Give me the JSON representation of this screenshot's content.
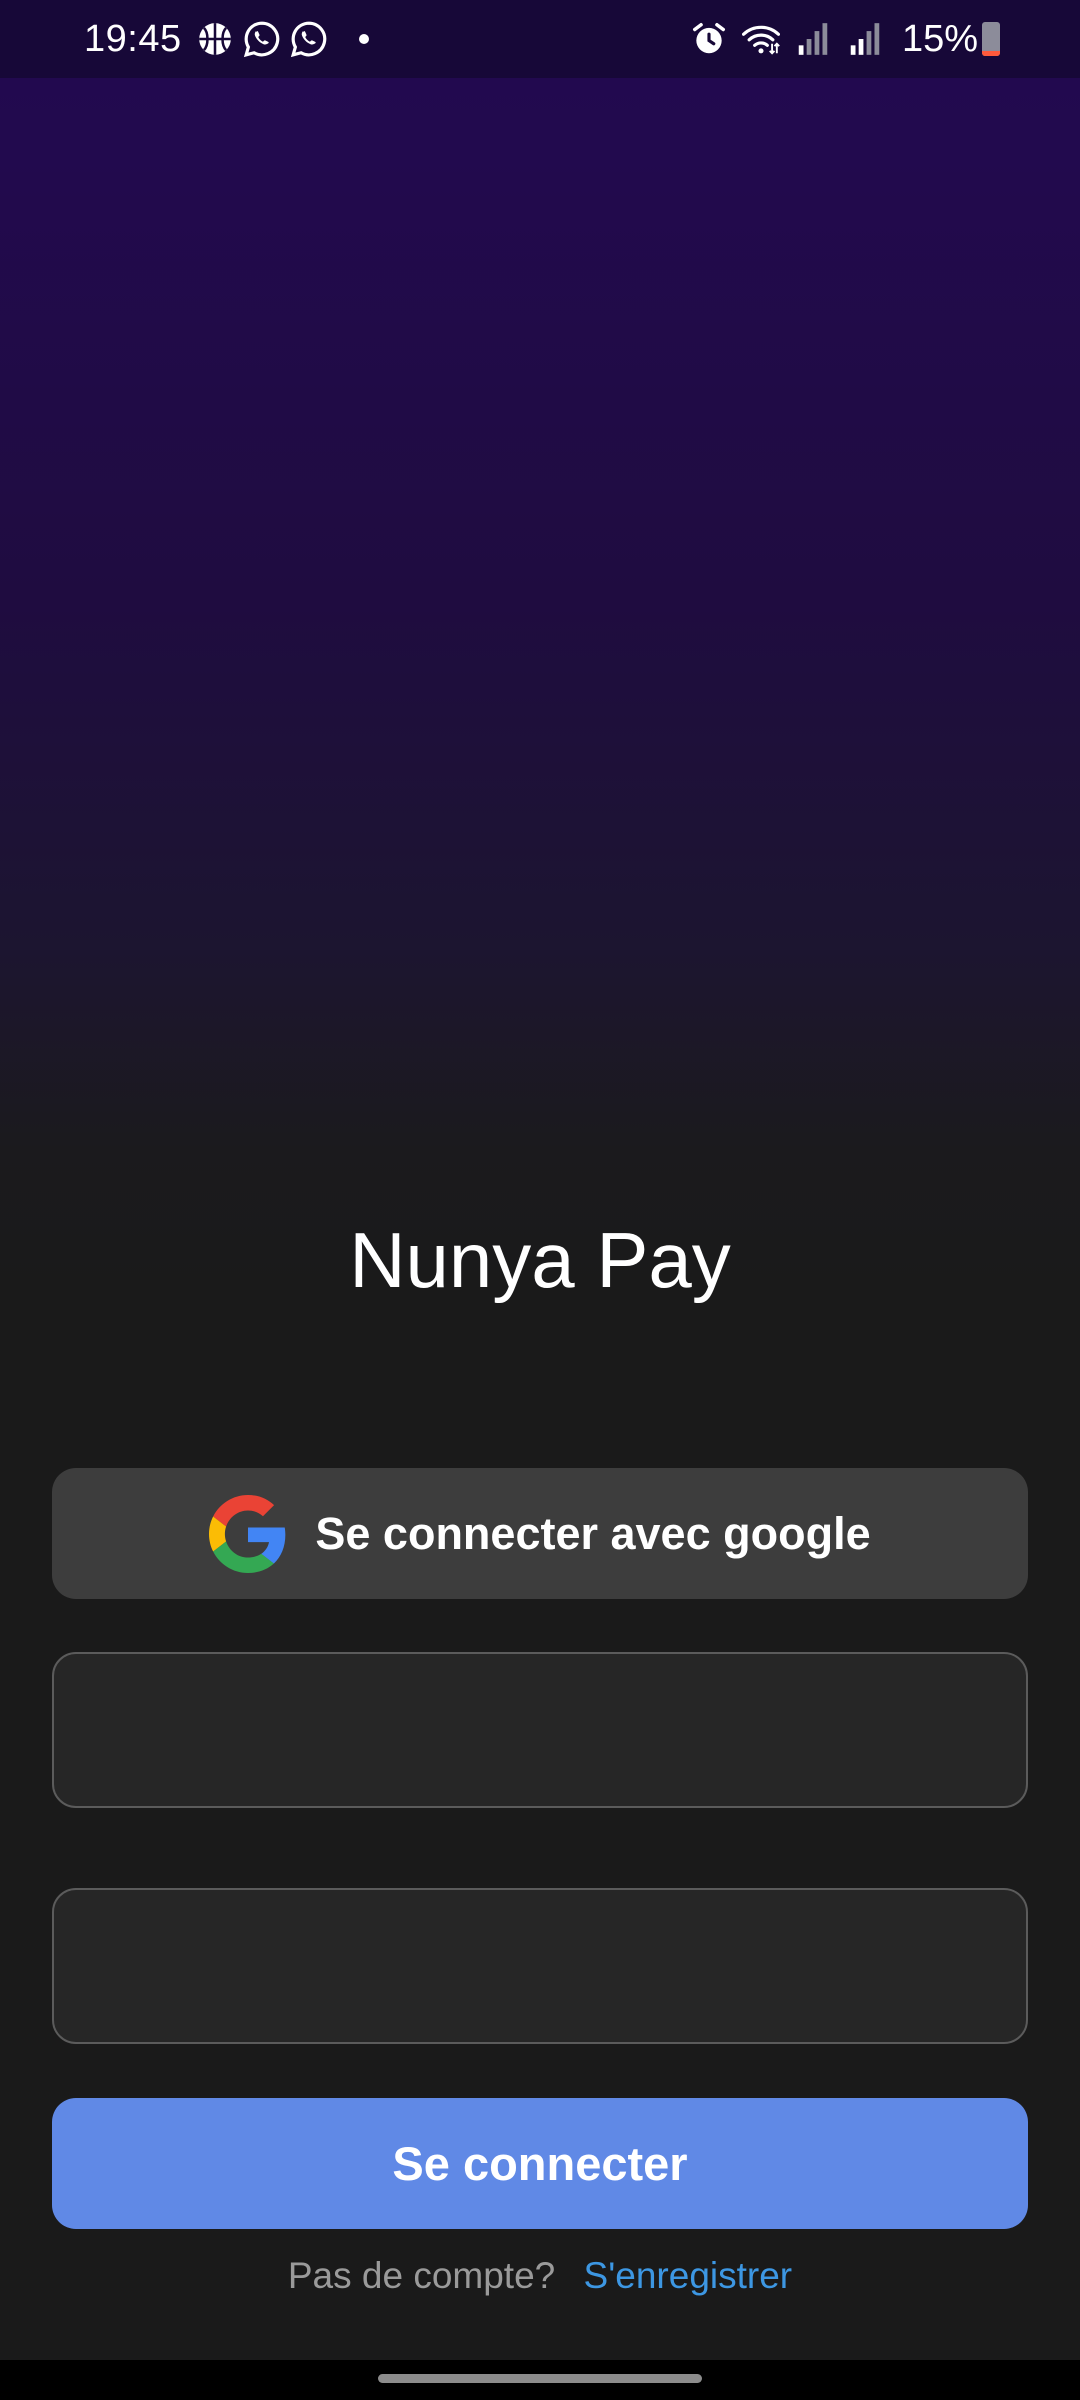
{
  "status_bar": {
    "time": "19:45",
    "battery_percent": "15%",
    "battery_level": 0.15,
    "left_icons": [
      "basketball-icon",
      "whatsapp-icon",
      "whatsapp-icon",
      "notification-dot-icon"
    ],
    "right_icons": [
      "alarm-icon",
      "wifi-icon",
      "signal-icon",
      "signal-icon",
      "battery-icon"
    ]
  },
  "app": {
    "title": "Nunya Pay"
  },
  "login": {
    "google_button_label": "Se connecter avec google",
    "email_field": {
      "value": "",
      "placeholder": ""
    },
    "password_field": {
      "value": "",
      "placeholder": ""
    },
    "submit_label": "Se connecter",
    "register_prompt": "Pas de compte?",
    "register_link": "S'enregistrer"
  },
  "colors": {
    "background": "#1a1a1a",
    "gradient_top": "#230850",
    "button_primary": "#6089e6",
    "button_google": "#3d3d3d",
    "link": "#3d97e3"
  }
}
